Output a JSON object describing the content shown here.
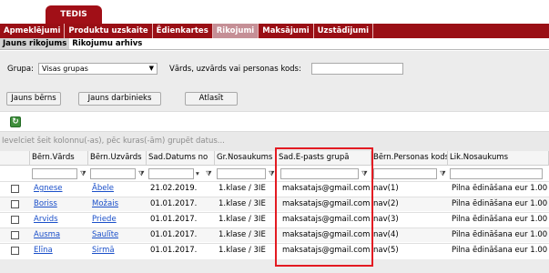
{
  "brand": {
    "title": "TEDIS"
  },
  "menu": [
    {
      "label": "Apmeklējumi",
      "name": "menu-apmeklejumi"
    },
    {
      "label": "Produktu uzskaite",
      "name": "menu-produktu-uzskaite"
    },
    {
      "label": "Ēdienkartes",
      "name": "menu-edienkartes"
    },
    {
      "label": "Rikojumi",
      "name": "menu-rikojumi",
      "active": true
    },
    {
      "label": "Maksājumi",
      "name": "menu-maksajumi"
    },
    {
      "label": "Uzstādījumi",
      "name": "menu-uzstadijumi"
    }
  ],
  "submenu": [
    {
      "label": "Jauns rikojums",
      "active": true
    },
    {
      "label": "Rikojumu arhivs"
    }
  ],
  "filters": {
    "group_label": "Grupa:",
    "group_value": "Visas grupas",
    "search_label": "Vārds, uzvārds vai personas kods:",
    "search_value": ""
  },
  "buttons": {
    "new_child": "Jauns bērns",
    "new_employee": "Jauns darbinieks",
    "reset": "Atlasīt"
  },
  "grid": {
    "group_hint": "Ievelciet šeit kolonnu(-as), pēc kuras(-ām) grupēt datus...",
    "columns": [
      "Bērn.Vārds",
      "Bērn.Uzvārds",
      "Sad.Datums no",
      "Gr.Nosaukums",
      "Sad.E-pasts grupā",
      "Bērn.Personas kods",
      "Lik.Nosaukums"
    ],
    "rows": [
      {
        "first": "Agnese",
        "last": "Ābele",
        "date": "21.02.2019.",
        "group": "1.klase / 3IE",
        "email": "maksatajs@gmail.com",
        "code": "nav(1)",
        "law": "Pilna ēdināšana eur 1.00"
      },
      {
        "first": "Boriss",
        "last": "Možais",
        "date": "01.01.2017.",
        "group": "1.klase / 3IE",
        "email": "maksatajs@gmail.com",
        "code": "nav(2)",
        "law": "Pilna ēdināšana eur 1.00"
      },
      {
        "first": "Arvids",
        "last": "Priede",
        "date": "01.01.2017.",
        "group": "1.klase / 3IE",
        "email": "maksatajs@gmail.com",
        "code": "nav(3)",
        "law": "Pilna ēdināšana eur 1.00"
      },
      {
        "first": "Ausma",
        "last": "Saulīte",
        "date": "01.01.2017.",
        "group": "1.klase / 3IE",
        "email": "maksatajs@gmail.com",
        "code": "nav(4)",
        "law": "Pilna ēdināšana eur 1.00"
      },
      {
        "first": "Elīna",
        "last": "Sirmā",
        "date": "01.01.2017.",
        "group": "1.klase / 3IE",
        "email": "maksatajs@gmail.com",
        "code": "nav(5)",
        "law": "Pilna ēdināšana eur 1.00"
      }
    ]
  },
  "colors": {
    "brand": "#9a0f15",
    "active_menu": "#c58f96",
    "highlight": "#e31b22",
    "link": "#1a4fc9"
  }
}
